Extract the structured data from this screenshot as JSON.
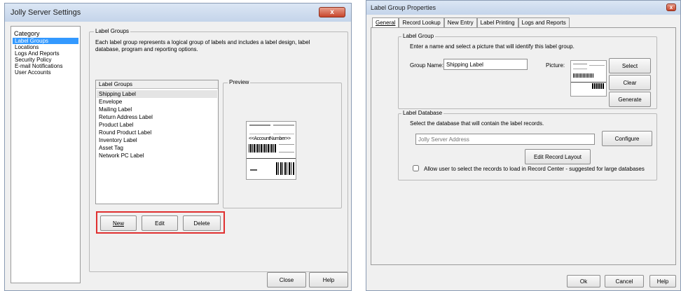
{
  "left_window": {
    "title": "Jolly Server Settings",
    "close_glyph": "x",
    "category": {
      "label": "Category",
      "items": [
        "Label Groups",
        "Locations",
        "Logs And Reports",
        "Security Policy",
        "E-mail Notifications",
        "User Accounts"
      ]
    },
    "section": {
      "legend": "Label Groups",
      "description": "Each label group represents a logical group of labels and includes a label design, label database, program and reporting options."
    },
    "list": {
      "header": "Label Groups",
      "items": [
        "Shipping Label",
        "Envelope",
        "Mailing Label",
        "Return Address Label",
        "Product Label",
        "Round Product Label",
        "Inventory Label",
        "Asset Tag",
        "Network PC Label"
      ]
    },
    "preview": {
      "legend": "Preview",
      "placeholder_text": "<<AccountNumber>>"
    },
    "buttons": {
      "new": "New",
      "edit": "Edit",
      "delete": "Delete",
      "close": "Close",
      "help": "Help"
    },
    "highlight_color": "#e03030"
  },
  "right_window": {
    "title": "Label Group Properties",
    "close_glyph": "x",
    "tabs": [
      "General",
      "Record Lookup",
      "New Entry",
      "Label Printing",
      "Logs and Reports"
    ],
    "label_group": {
      "legend": "Label Group",
      "instruction": "Enter a name and select a picture that will identify this label group.",
      "group_name_label": "Group Name:",
      "group_name_value": "Shipping Label",
      "picture_label": "Picture:",
      "buttons": {
        "select": "Select",
        "clear": "Clear",
        "generate": "Generate"
      }
    },
    "label_database": {
      "legend": "Label Database",
      "instruction": "Select the database that will contain the label records.",
      "database_placeholder": "Jolly Server Address",
      "configure_button": "Configure",
      "edit_layout_button": "Edit Record Layout",
      "checkbox_label": "Allow user to select the records to load in Record Center - suggested for large databases",
      "checkbox_checked": false
    },
    "buttons": {
      "ok": "Ok",
      "cancel": "Cancel",
      "help": "Help"
    }
  }
}
